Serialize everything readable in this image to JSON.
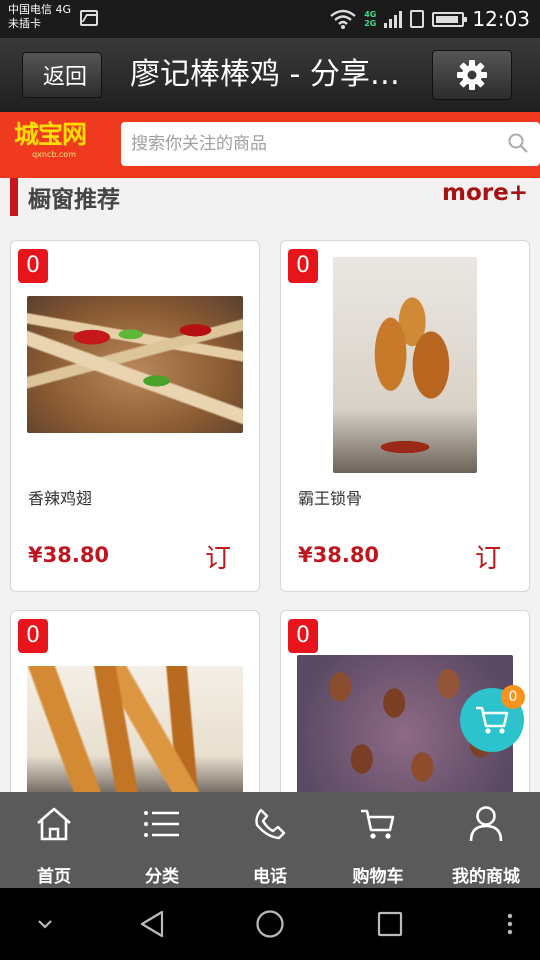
{
  "status": {
    "carrier_line1": "中国电信 4G",
    "carrier_line2": "未插卡",
    "network_type": "4G 2G",
    "time": "12:03"
  },
  "header": {
    "back_label": "返回",
    "title": "廖记棒棒鸡 - 分享…"
  },
  "search": {
    "logo_text": "城宝网",
    "logo_sub": "qxncb.com",
    "placeholder": "搜索你关注的商品"
  },
  "section": {
    "title": "橱窗推荐",
    "more": "more+"
  },
  "products": [
    {
      "name": "香辣鸡翅",
      "price": "¥38.80",
      "badge": "0",
      "order_label": "订"
    },
    {
      "name": "霸王锁骨",
      "price": "¥38.80",
      "badge": "0",
      "order_label": "订"
    },
    {
      "name": "",
      "price": "",
      "badge": "0",
      "order_label": ""
    },
    {
      "name": "",
      "price": "",
      "badge": "0",
      "order_label": ""
    }
  ],
  "cart_float": {
    "count": "0"
  },
  "bottom_nav": [
    {
      "label": "首页",
      "icon": "home-icon"
    },
    {
      "label": "分类",
      "icon": "list-icon"
    },
    {
      "label": "电话",
      "icon": "phone-icon"
    },
    {
      "label": "购物车",
      "icon": "cart-icon"
    },
    {
      "label": "我的商城",
      "icon": "user-icon"
    }
  ],
  "colors": {
    "brand_red": "#ef3a1f",
    "price_red": "#c0161e",
    "cart_teal": "#2cc3cc",
    "nav_bg": "#5a5a5a"
  }
}
